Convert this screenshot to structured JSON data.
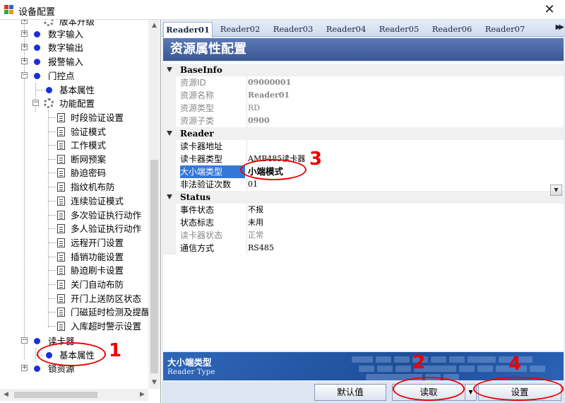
{
  "window": {
    "title": "设备配置",
    "close_label": "✕"
  },
  "tree": {
    "nodes": [
      {
        "label": "版本升级"
      },
      {
        "label": "数字输入"
      },
      {
        "label": "数字输出"
      },
      {
        "label": "报警输入"
      },
      {
        "label": "门控点"
      },
      {
        "label": "基本属性"
      },
      {
        "label": "功能配置"
      },
      {
        "label": "时段验证设置"
      },
      {
        "label": "验证模式"
      },
      {
        "label": "工作模式"
      },
      {
        "label": "断网预案"
      },
      {
        "label": "胁迫密码"
      },
      {
        "label": "指纹机布防"
      },
      {
        "label": "连续验证模式"
      },
      {
        "label": "多次验证执行动作"
      },
      {
        "label": "多人验证执行动作"
      },
      {
        "label": "远程开门设置"
      },
      {
        "label": "插销功能设置"
      },
      {
        "label": "胁迫刷卡设置"
      },
      {
        "label": "关门自动布防"
      },
      {
        "label": "开门上送防区状态"
      },
      {
        "label": "门磁延时检测及提醒"
      },
      {
        "label": "入库超时警示设置"
      },
      {
        "label": "读卡器"
      },
      {
        "label": "基本属性"
      },
      {
        "label": "锁资源"
      }
    ]
  },
  "tabs": [
    "Reader01",
    "Reader02",
    "Reader03",
    "Reader04",
    "Reader05",
    "Reader06",
    "Reader07"
  ],
  "header": {
    "title": "资源属性配置"
  },
  "grid": {
    "cat_baseinfo": "BaseInfo",
    "resource_id": {
      "name": "资源ID",
      "value": "09000001"
    },
    "resource_name": {
      "name": "资源名称",
      "value": "Reader01"
    },
    "resource_type": {
      "name": "资源类型",
      "value": "RD"
    },
    "resource_subtype": {
      "name": "资源子类",
      "value": "0900"
    },
    "cat_reader": "Reader",
    "reader_addr": {
      "name": "读卡器地址",
      "value": ""
    },
    "reader_type": {
      "name": "读卡器类型",
      "value": "AMB485读卡器"
    },
    "endian_type": {
      "name": "大小端类型",
      "value": "小端模式"
    },
    "illegal_count": {
      "name": "非法验证次数",
      "value": "01"
    },
    "cat_status": "Status",
    "event_status": {
      "name": "事件状态",
      "value": "不报"
    },
    "status_flag": {
      "name": "状态标志",
      "value": "未用"
    },
    "reader_status": {
      "name": "读卡器状态",
      "value": "正常"
    },
    "comm_mode": {
      "name": "通信方式",
      "value": "RS485"
    }
  },
  "description": {
    "title": "大小端类型",
    "text": "Reader Type"
  },
  "buttons": {
    "default": "默认值",
    "read": "读取",
    "set": "设置"
  },
  "annotations": [
    "1",
    "2",
    "3",
    "4"
  ],
  "colors": {
    "annotation": "#e00000",
    "header": "#3f5c9a",
    "selected": "#3377d8",
    "tree_dot": "#1a2fd6"
  }
}
